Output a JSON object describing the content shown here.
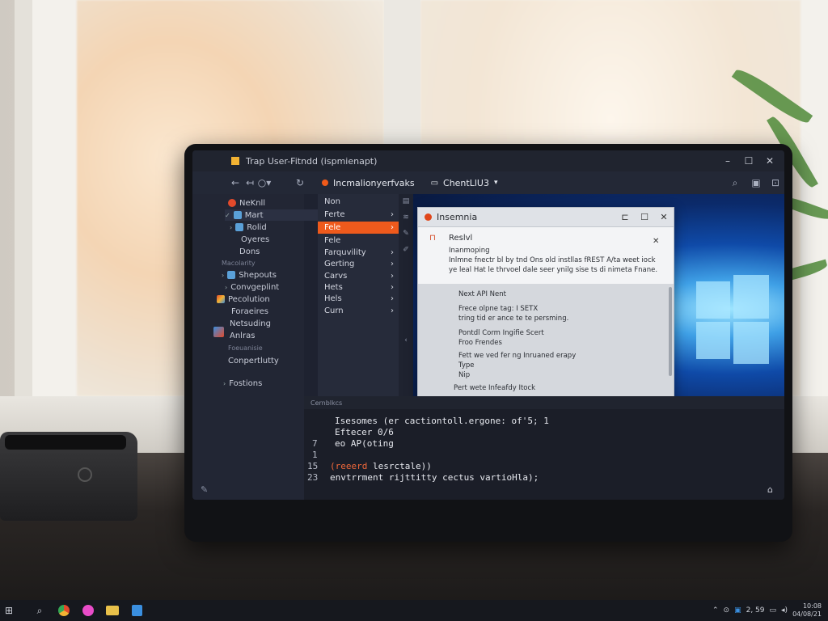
{
  "window": {
    "title": "Trap User-Fitndd (ispmienapt)"
  },
  "toolbar": {
    "active_tab": "Incmalionyerfvaks",
    "second_tab": "ChentLlU3"
  },
  "sidebar": {
    "items": [
      "NeKnll",
      "Mart",
      "Rolid",
      "Oyeres",
      "Dons"
    ],
    "section1": "Macolarity",
    "items2": [
      "Shepouts",
      "Convgeplint",
      "Pecolution",
      "Foraeires",
      "Netsuding",
      "Anlras"
    ],
    "section2": "Foeuanisie",
    "items3": [
      "Conpertlutty",
      "Fostions"
    ]
  },
  "submenu": {
    "items": [
      "Non",
      "Ferte",
      "Fele",
      "Fele",
      "Farquvility",
      "Gerting",
      "Carvs",
      "Hets",
      "Hels",
      "Curn"
    ]
  },
  "dialog": {
    "title": "Insemnia",
    "heading": "Reslvl",
    "subheading": "Inanmoping",
    "desc1": "Inlmne fnectr bl by tnd Ons old instllas fREST A/ta weet iock",
    "desc2": "ye leal Hat le thrvoel dale seer ynilg sise ts di nimeta Fnane.",
    "body": [
      "Next API Nent",
      "Frece olpne tag: I SETX",
      "tring tid er ance te te persming.",
      "Pontdl Corm Ingifie Scert",
      "Froo      Frendes",
      "Fett we ved fer ng Inruaned erapy",
      "Type",
      "Nip",
      "Pert wete Infeafdy Itock"
    ]
  },
  "console": {
    "tab": "Cernblkcs",
    "lines": [
      {
        "num": "",
        "text": "Isesomes (er cactiontoll.ergone: of'5; 1",
        "highlight": ""
      },
      {
        "num": "",
        "text": "Eftecer 0/6",
        "highlight": ""
      },
      {
        "num": "7",
        "text": "eo AP(oting",
        "highlight": ""
      },
      {
        "num": "1",
        "text": "",
        "highlight": ""
      },
      {
        "num": "15",
        "text": " lesrctale))",
        "highlight": "(reeerd"
      },
      {
        "num": "23",
        "text": "envtrrment rijttitty cectus vartioHla);",
        "highlight": ""
      }
    ]
  },
  "taskbar": {
    "tray_text": "2, 59",
    "clock_time": "10:08",
    "clock_date": "04/08/21"
  },
  "colors": {
    "accent": "#ef5a1c",
    "sidebar_bg": "#222634",
    "desktop_blue": "#0f4aa8"
  }
}
